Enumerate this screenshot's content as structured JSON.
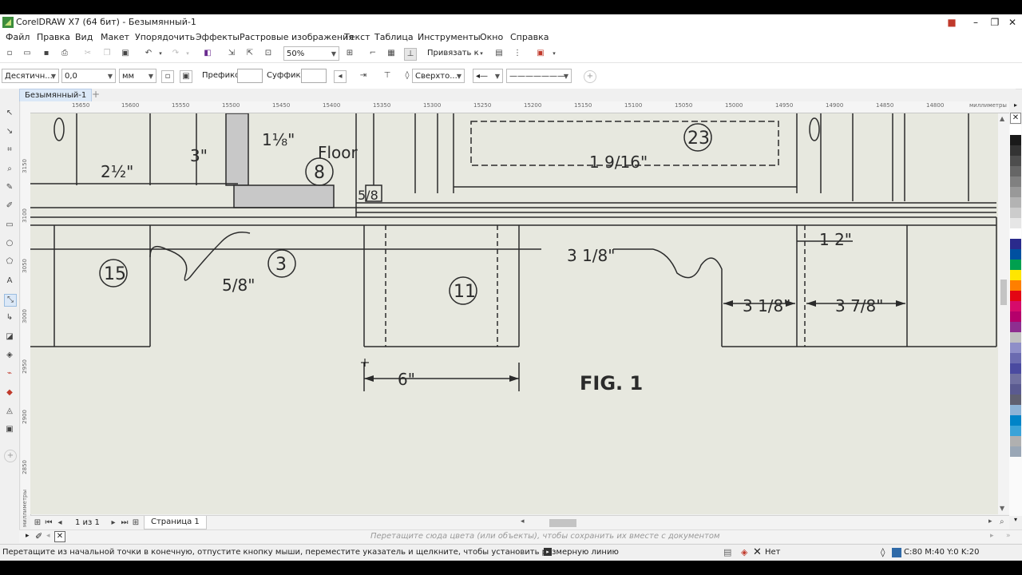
{
  "window": {
    "title": "CorelDRAW X7 (64 бит) - Безымянный-1",
    "controls": [
      "minimize",
      "restore",
      "close"
    ]
  },
  "menu": [
    "Файл",
    "Правка",
    "Вид",
    "Макет",
    "Упорядочить",
    "Эффекты",
    "Растровые изображения",
    "Текст",
    "Таблица",
    "Инструменты",
    "Окно",
    "Справка"
  ],
  "toolbar1": {
    "zoom": "50%",
    "snap_label": "Привязать к"
  },
  "toolbar2": {
    "units_style": "Десятичн...",
    "precision": "0,0",
    "units": "мм",
    "prefix_label": "Префикс:",
    "prefix_value": "",
    "suffix_label": "Суффикс:",
    "suffix_value": "",
    "text_position": "Сверхто..."
  },
  "document": {
    "tab": "Безымянный-1",
    "ruler_unit": "миллиметры",
    "hruler_ticks": [
      "15650",
      "15600",
      "15550",
      "15500",
      "15450",
      "15400",
      "15350",
      "15300",
      "15250",
      "15200",
      "15150",
      "15100",
      "15050",
      "15000",
      "14950",
      "14900",
      "14850",
      "14800"
    ],
    "vruler_ticks": [
      "3150",
      "3100",
      "3050",
      "3000",
      "2950",
      "2900",
      "2850"
    ]
  },
  "drawing": {
    "fig_label": "FIG. 1",
    "floor_label": "Floor",
    "callouts": [
      "15",
      "3",
      "11",
      "8",
      "23"
    ],
    "dims": [
      "2½\"",
      "3\"",
      "1⅛\"",
      "5/8\"",
      "1 9/16\"",
      "3 1/8\"",
      "1 2\"",
      "3 1/8\"",
      "3 7/8\"",
      "6\"",
      "5/8"
    ]
  },
  "pagebar": {
    "page_count": "1 из 1",
    "page_tab": "Страница 1"
  },
  "colorbar": {
    "hint": "Перетащите сюда цвета (или объекты), чтобы сохранить их вместе с документом"
  },
  "status": {
    "message": "Перетащите из начальной точки в конечную, отпустите кнопку мыши, переместите указатель и щелкните, чтобы установить размерную линию",
    "fill": "Нет",
    "outline": "C:80 M:40 Y:0 K:20"
  },
  "colors": {
    "palette": [
      "#ffffff",
      "#1a1a1a",
      "#333333",
      "#4d4d4d",
      "#666666",
      "#808080",
      "#999999",
      "#b3b3b3",
      "#cccccc",
      "#e6e6e6",
      "#ffffff",
      "#2a2a8c",
      "#0050a0",
      "#00a04f",
      "#ffe600",
      "#ff7f00",
      "#e30613",
      "#d60b6a",
      "#b5006b",
      "#8e2e90",
      "#c1c1c1",
      "#8f8fc8",
      "#6b6bb0",
      "#4a4aa0",
      "#7070a0",
      "#5a5a90",
      "#606070",
      "#8db3d6",
      "#0084c8",
      "#3aa3d8",
      "#b0b0b0",
      "#9aa7b6"
    ]
  }
}
